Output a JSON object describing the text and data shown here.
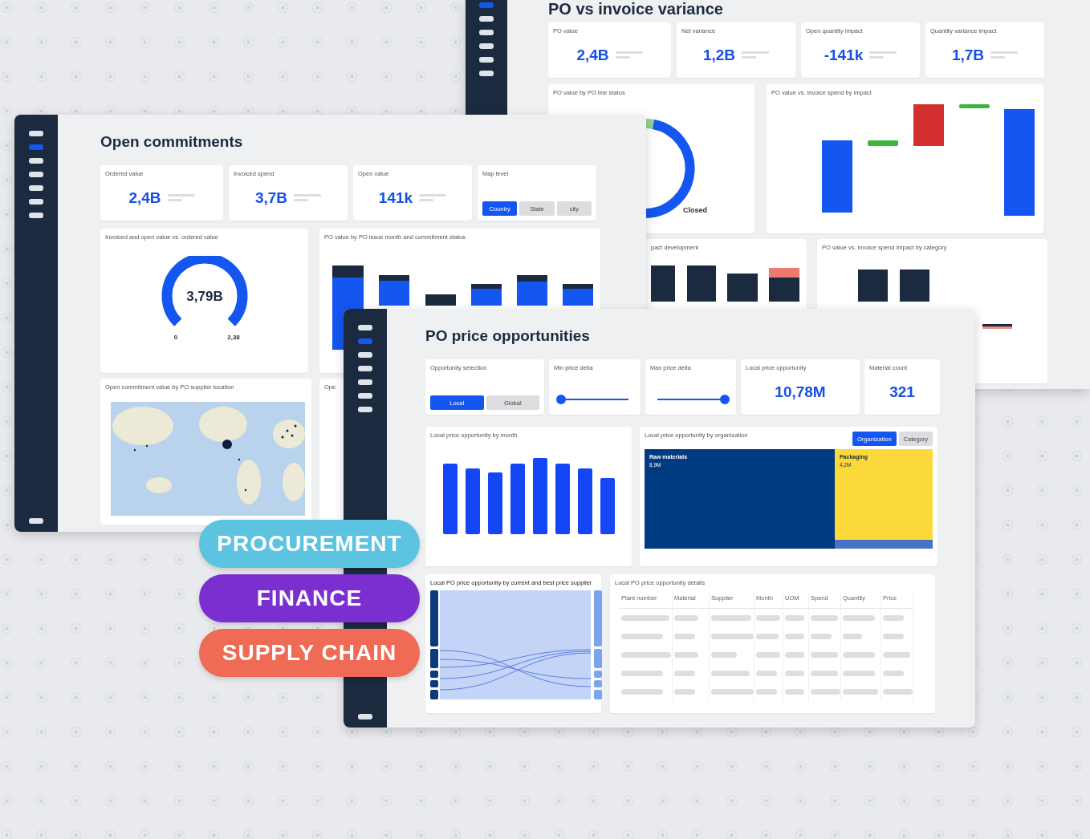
{
  "variance_window": {
    "title": "PO vs invoice variance",
    "sidebar": {
      "items": [
        {
          "selected": true
        },
        {
          "selected": false
        },
        {
          "selected": false
        },
        {
          "selected": false
        },
        {
          "selected": false
        },
        {
          "selected": false
        }
      ]
    },
    "kpis": [
      {
        "label": "PO value",
        "value": "2,4B"
      },
      {
        "label": "Net variance",
        "value": "1,2B"
      },
      {
        "label": "Open quantity impact",
        "value": "-141k"
      },
      {
        "label": "Quantity variance impact",
        "value": "1,7B"
      }
    ],
    "status_chart": {
      "title": "PO value by PO line status",
      "segment_label": "Closed"
    },
    "impact_chart": {
      "title": "PO value vs. invoice spend by impact"
    },
    "development_chart": {
      "title": "pact development"
    },
    "category_chart": {
      "title": "PO value vs. invoice spend impact by category"
    }
  },
  "commitments_window": {
    "title": "Open commitments",
    "sidebar": {
      "items": [
        {
          "selected": false
        },
        {
          "selected": true
        },
        {
          "selected": false
        },
        {
          "selected": false
        },
        {
          "selected": false
        },
        {
          "selected": false
        },
        {
          "selected": false
        }
      ]
    },
    "kpis": [
      {
        "label": "Ordered value",
        "value": "2,4B"
      },
      {
        "label": "Invoiced spend",
        "value": "3,7B"
      },
      {
        "label": "Open value",
        "value": "141k"
      }
    ],
    "map_level": {
      "label": "Map level",
      "options": [
        {
          "label": "Country",
          "selected": true
        },
        {
          "label": "State",
          "selected": false
        },
        {
          "label": "city",
          "selected": false
        }
      ]
    },
    "gauge": {
      "title": "Invoiced and open value vs. ordered value",
      "value": "3,79B",
      "min_label": "0",
      "max_label": "2,38"
    },
    "bar_chart": {
      "title": "PO value by PO issue month and commitment status"
    },
    "map": {
      "title": "Open commitment value by PO supplier location"
    },
    "hidden_card": {
      "title": "Ope"
    }
  },
  "opportunities_window": {
    "title": "PO price opportunities",
    "sidebar": {
      "items": [
        {
          "selected": false
        },
        {
          "selected": true
        },
        {
          "selected": false
        },
        {
          "selected": false
        },
        {
          "selected": false
        },
        {
          "selected": false
        },
        {
          "selected": false
        }
      ]
    },
    "selection": {
      "label": "Opportunity selection",
      "options": [
        {
          "label": "Local",
          "selected": true
        },
        {
          "label": "Global",
          "selected": false
        }
      ]
    },
    "sliders": [
      {
        "label": "Min price delta",
        "level": 0
      },
      {
        "label": "Max price delta",
        "level": 1
      }
    ],
    "kpis": [
      {
        "label": "Local price opportunity",
        "value": "10,78M"
      },
      {
        "label": "Material count",
        "value": "321"
      }
    ],
    "month_chart": {
      "title": "Local price opportunity by month"
    },
    "treemap": {
      "title": "Local price opportunity by organization",
      "options": [
        {
          "label": "Organization",
          "selected": true
        },
        {
          "label": "Category",
          "selected": false
        }
      ],
      "tiles": [
        {
          "label": "Raw materials",
          "value": "8,9M",
          "color": "#003a80"
        },
        {
          "label": "Packaging",
          "value": "4,2M",
          "color": "#fbd93a"
        }
      ]
    },
    "sankey": {
      "title": "Local PO price opportunity by current and best price supplier"
    },
    "table": {
      "title": "Local PO price opportunity details",
      "columns": [
        "Plant number",
        "Material",
        "Supplier",
        "Month",
        "UOM",
        "Spend",
        "Quantity",
        "Price"
      ]
    }
  },
  "tags": [
    {
      "label": "PROCUREMENT",
      "color": "#5cc3e0"
    },
    {
      "label": "FINANCE",
      "color": "#7b2fd1"
    },
    {
      "label": "SUPPLY CHAIN",
      "color": "#f06b56"
    }
  ]
}
